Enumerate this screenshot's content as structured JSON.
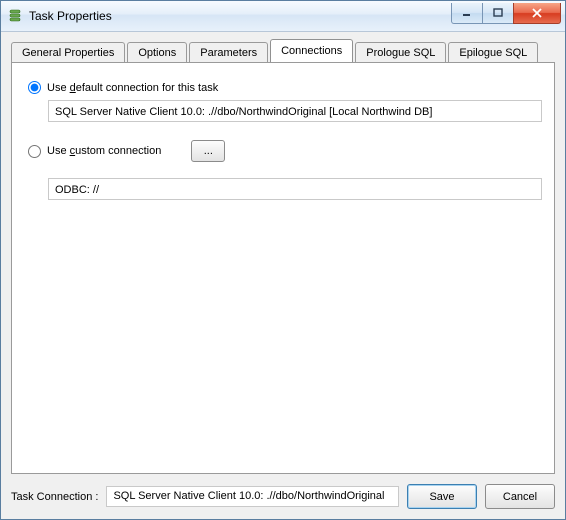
{
  "window": {
    "title": "Task Properties"
  },
  "tabs": {
    "general": "General Properties",
    "options": "Options",
    "parameters": "Parameters",
    "connections": "Connections",
    "prologue": "Prologue SQL",
    "epilogue": "Epilogue SQL"
  },
  "connections": {
    "default_radio_label_pre": "Use ",
    "default_radio_label_u": "d",
    "default_radio_label_post": "efault connection for this task",
    "default_value": "SQL Server Native Client 10.0: .//dbo/NorthwindOriginal [Local Northwind DB]",
    "custom_radio_label_pre": "Use ",
    "custom_radio_label_u": "c",
    "custom_radio_label_post": "ustom connection",
    "browse_label": "...",
    "custom_value": "ODBC: //",
    "selected": "default"
  },
  "footer": {
    "label": "Task Connection :",
    "value": "SQL Server Native Client 10.0: .//dbo/NorthwindOriginal",
    "save": "Save",
    "cancel": "Cancel"
  }
}
